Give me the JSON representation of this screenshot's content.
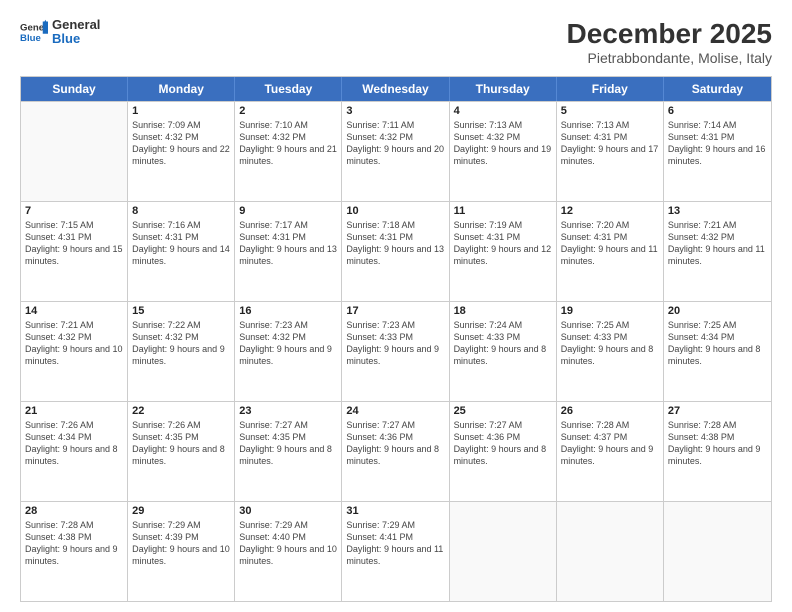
{
  "logo": {
    "general": "General",
    "blue": "Blue"
  },
  "title": "December 2025",
  "subtitle": "Pietrabbondante, Molise, Italy",
  "days": [
    "Sunday",
    "Monday",
    "Tuesday",
    "Wednesday",
    "Thursday",
    "Friday",
    "Saturday"
  ],
  "weeks": [
    [
      {
        "num": "",
        "empty": true
      },
      {
        "num": "1",
        "sunrise": "7:09 AM",
        "sunset": "4:32 PM",
        "daylight": "9 hours and 22 minutes."
      },
      {
        "num": "2",
        "sunrise": "7:10 AM",
        "sunset": "4:32 PM",
        "daylight": "9 hours and 21 minutes."
      },
      {
        "num": "3",
        "sunrise": "7:11 AM",
        "sunset": "4:32 PM",
        "daylight": "9 hours and 20 minutes."
      },
      {
        "num": "4",
        "sunrise": "7:13 AM",
        "sunset": "4:32 PM",
        "daylight": "9 hours and 19 minutes."
      },
      {
        "num": "5",
        "sunrise": "7:13 AM",
        "sunset": "4:31 PM",
        "daylight": "9 hours and 17 minutes."
      },
      {
        "num": "6",
        "sunrise": "7:14 AM",
        "sunset": "4:31 PM",
        "daylight": "9 hours and 16 minutes."
      }
    ],
    [
      {
        "num": "7",
        "sunrise": "7:15 AM",
        "sunset": "4:31 PM",
        "daylight": "9 hours and 15 minutes."
      },
      {
        "num": "8",
        "sunrise": "7:16 AM",
        "sunset": "4:31 PM",
        "daylight": "9 hours and 14 minutes."
      },
      {
        "num": "9",
        "sunrise": "7:17 AM",
        "sunset": "4:31 PM",
        "daylight": "9 hours and 13 minutes."
      },
      {
        "num": "10",
        "sunrise": "7:18 AM",
        "sunset": "4:31 PM",
        "daylight": "9 hours and 13 minutes."
      },
      {
        "num": "11",
        "sunrise": "7:19 AM",
        "sunset": "4:31 PM",
        "daylight": "9 hours and 12 minutes."
      },
      {
        "num": "12",
        "sunrise": "7:20 AM",
        "sunset": "4:31 PM",
        "daylight": "9 hours and 11 minutes."
      },
      {
        "num": "13",
        "sunrise": "7:21 AM",
        "sunset": "4:32 PM",
        "daylight": "9 hours and 11 minutes."
      }
    ],
    [
      {
        "num": "14",
        "sunrise": "7:21 AM",
        "sunset": "4:32 PM",
        "daylight": "9 hours and 10 minutes."
      },
      {
        "num": "15",
        "sunrise": "7:22 AM",
        "sunset": "4:32 PM",
        "daylight": "9 hours and 9 minutes."
      },
      {
        "num": "16",
        "sunrise": "7:23 AM",
        "sunset": "4:32 PM",
        "daylight": "9 hours and 9 minutes."
      },
      {
        "num": "17",
        "sunrise": "7:23 AM",
        "sunset": "4:33 PM",
        "daylight": "9 hours and 9 minutes."
      },
      {
        "num": "18",
        "sunrise": "7:24 AM",
        "sunset": "4:33 PM",
        "daylight": "9 hours and 8 minutes."
      },
      {
        "num": "19",
        "sunrise": "7:25 AM",
        "sunset": "4:33 PM",
        "daylight": "9 hours and 8 minutes."
      },
      {
        "num": "20",
        "sunrise": "7:25 AM",
        "sunset": "4:34 PM",
        "daylight": "9 hours and 8 minutes."
      }
    ],
    [
      {
        "num": "21",
        "sunrise": "7:26 AM",
        "sunset": "4:34 PM",
        "daylight": "9 hours and 8 minutes."
      },
      {
        "num": "22",
        "sunrise": "7:26 AM",
        "sunset": "4:35 PM",
        "daylight": "9 hours and 8 minutes."
      },
      {
        "num": "23",
        "sunrise": "7:27 AM",
        "sunset": "4:35 PM",
        "daylight": "9 hours and 8 minutes."
      },
      {
        "num": "24",
        "sunrise": "7:27 AM",
        "sunset": "4:36 PM",
        "daylight": "9 hours and 8 minutes."
      },
      {
        "num": "25",
        "sunrise": "7:27 AM",
        "sunset": "4:36 PM",
        "daylight": "9 hours and 8 minutes."
      },
      {
        "num": "26",
        "sunrise": "7:28 AM",
        "sunset": "4:37 PM",
        "daylight": "9 hours and 9 minutes."
      },
      {
        "num": "27",
        "sunrise": "7:28 AM",
        "sunset": "4:38 PM",
        "daylight": "9 hours and 9 minutes."
      }
    ],
    [
      {
        "num": "28",
        "sunrise": "7:28 AM",
        "sunset": "4:38 PM",
        "daylight": "9 hours and 9 minutes."
      },
      {
        "num": "29",
        "sunrise": "7:29 AM",
        "sunset": "4:39 PM",
        "daylight": "9 hours and 10 minutes."
      },
      {
        "num": "30",
        "sunrise": "7:29 AM",
        "sunset": "4:40 PM",
        "daylight": "9 hours and 10 minutes."
      },
      {
        "num": "31",
        "sunrise": "7:29 AM",
        "sunset": "4:41 PM",
        "daylight": "9 hours and 11 minutes."
      },
      {
        "num": "",
        "empty": true
      },
      {
        "num": "",
        "empty": true
      },
      {
        "num": "",
        "empty": true
      }
    ]
  ]
}
